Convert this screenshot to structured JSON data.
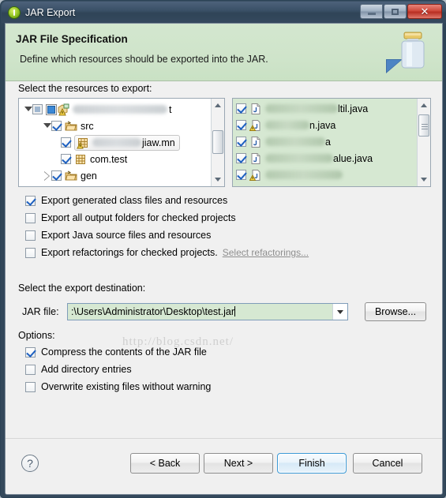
{
  "window": {
    "title": "JAR Export",
    "icon": "eclipse-wizard-icon",
    "minimize_label": "",
    "maximize_label": "",
    "close_label": "✕"
  },
  "banner": {
    "heading": "JAR File Specification",
    "subheading": "Define which resources should be exported into the JAR.",
    "icon": "jar-jar-icon"
  },
  "resources": {
    "label": "Select the resources to export:",
    "tree": [
      {
        "indent": 0,
        "twisty": "open",
        "check": "grey",
        "icon": "java-project-icon",
        "label": "",
        "blur_width": 120,
        "suffix": "t"
      },
      {
        "indent": 1,
        "twisty": "open",
        "check": "on",
        "icon": "source-folder-icon",
        "label": "src",
        "blur_width": 0,
        "suffix": ""
      },
      {
        "indent": 2,
        "twisty": "none",
        "check": "on",
        "icon": "package-warn-icon",
        "label": "jiaw.mn",
        "blur_width": 62,
        "suffix": "",
        "selected": true
      },
      {
        "indent": 2,
        "twisty": "none",
        "check": "on",
        "icon": "package-icon",
        "label": "com.test",
        "blur_width": 0,
        "suffix": ""
      },
      {
        "indent": 1,
        "twisty": "closed",
        "check": "on",
        "icon": "source-folder-icon",
        "label": "gen",
        "blur_width": 0,
        "suffix": ""
      }
    ],
    "files": [
      {
        "check": "on",
        "icon": "java-file-icon",
        "blur_width": 92,
        "label": "ltil.java"
      },
      {
        "check": "on",
        "icon": "java-file-warn-icon",
        "blur_width": 56,
        "label": "n.java"
      },
      {
        "check": "on",
        "icon": "java-file-icon",
        "blur_width": 76,
        "label": "a"
      },
      {
        "check": "on",
        "icon": "java-file-icon",
        "blur_width": 86,
        "label": "alue.java"
      },
      {
        "check": "on",
        "icon": "java-file-warn-icon",
        "blur_width": 98,
        "label": ""
      }
    ]
  },
  "export_options": [
    {
      "label": "Export generated class files and resources",
      "checked": true
    },
    {
      "label": "Export all output folders for checked projects",
      "checked": false
    },
    {
      "label": "Export Java source files and resources",
      "checked": false
    },
    {
      "label": "Export refactorings for checked projects.",
      "checked": false,
      "link": "Select refactorings..."
    }
  ],
  "destination": {
    "label": "Select the export destination:",
    "jar_file_label": "JAR file:",
    "jar_file_value": ":\\Users\\Administrator\\Desktop\\test.jar",
    "jar_file_placeholder": "",
    "browse_label": "Browse..."
  },
  "options": {
    "label": "Options:",
    "items": [
      {
        "label": "Compress the contents of the JAR file",
        "checked": true
      },
      {
        "label": "Add directory entries",
        "checked": false
      },
      {
        "label": "Overwrite existing files without warning",
        "checked": false
      }
    ]
  },
  "footer": {
    "help_label": "?",
    "back_label": "< Back",
    "next_label": "Next >",
    "finish_label": "Finish",
    "cancel_label": "Cancel"
  },
  "watermark": "http://blog.csdn.net/",
  "colors": {
    "banner_bg": "#cfe4ca",
    "selection_green": "#d6e8d2",
    "titlebar": "#35495e",
    "close_red": "#c8382a",
    "default_button_border": "#3c9ad6"
  }
}
